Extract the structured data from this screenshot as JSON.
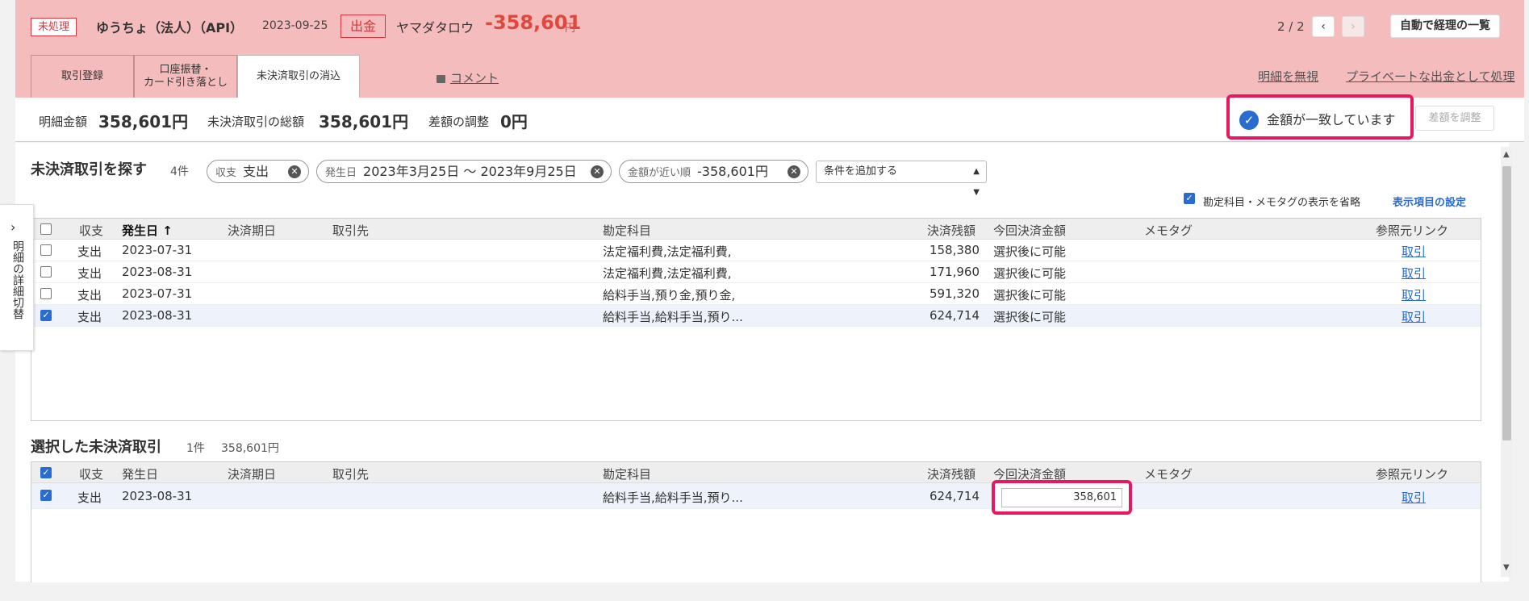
{
  "header": {
    "status_tag": "未処理",
    "account_name": "ゆうちょ（法人）（API）",
    "date": "2023-09-25",
    "direction": "出金",
    "payee": "ヤマダタロウ",
    "amount": "-358,601",
    "amount_unit": "円",
    "pager_text": "2 / 2",
    "pager_prev": "‹",
    "pager_next": "›",
    "auto_list_button": "自動で経理の一覧"
  },
  "tabs": [
    {
      "label": "取引登録"
    },
    {
      "label": "口座振替・\nカード引き落とし"
    },
    {
      "label": "未決済取引の消込"
    }
  ],
  "links": {
    "comment": "コメント",
    "ignore": "明細を無視",
    "private": "プライベートな出金として処理"
  },
  "summary": {
    "detail_amount_label": "明細金額",
    "detail_amount_value": "358,601円",
    "unsettled_total_label": "未決済取引の総額",
    "unsettled_total_value": "358,601円",
    "diff_label": "差額の調整",
    "diff_value": "0円",
    "match_text": "金額が一致しています",
    "match_check": "✓",
    "adjust_button": "差額を調整"
  },
  "search": {
    "title": "未決済取引を探す",
    "count": "4件",
    "chips": [
      {
        "label": "収支",
        "value": "支出"
      },
      {
        "label": "発生日",
        "value": "2023年3月25日 〜 2023年9月25日"
      },
      {
        "label": "金額が近い順",
        "value": "-358,601円"
      }
    ],
    "chip_close": "✕",
    "add_condition": "条件を追加する",
    "omit_label": "勘定科目・メモタグの表示を省略",
    "settings_link": "表示項目の設定"
  },
  "columns": {
    "income": "収支",
    "date": "発生日",
    "date_sorted": "発生日 ↑",
    "due": "決済期日",
    "partner": "取引先",
    "account": "勘定科目",
    "balance": "決済残額",
    "this_amount": "今回決済金額",
    "memo": "メモタグ",
    "ref": "参照元リンク"
  },
  "search_rows": [
    {
      "type": "支出",
      "date": "2023-07-31",
      "account": "法定福利費,法定福利費,",
      "balance": "158,380",
      "this_amount": "選択後に可能",
      "ref": "取引",
      "checked": false
    },
    {
      "type": "支出",
      "date": "2023-08-31",
      "account": "法定福利費,法定福利費,",
      "balance": "171,960",
      "this_amount": "選択後に可能",
      "ref": "取引",
      "checked": false
    },
    {
      "type": "支出",
      "date": "2023-07-31",
      "account": "給料手当,預り金,預り金,",
      "balance": "591,320",
      "this_amount": "選択後に可能",
      "ref": "取引",
      "checked": false
    },
    {
      "type": "支出",
      "date": "2023-08-31",
      "account": "給料手当,給料手当,預り...",
      "balance": "624,714",
      "this_amount": "選択後に可能",
      "ref": "取引",
      "checked": true
    }
  ],
  "selected": {
    "title": "選択した未決済取引",
    "count": "1件",
    "total": "358,601円",
    "rows": [
      {
        "type": "支出",
        "date": "2023-08-31",
        "account": "給料手当,給料手当,預り...",
        "balance": "624,714",
        "this_amount": "358,601",
        "ref": "取引",
        "checked": true
      }
    ]
  },
  "side_toggle": {
    "arrow": "›",
    "label": "明細の詳細切替"
  }
}
